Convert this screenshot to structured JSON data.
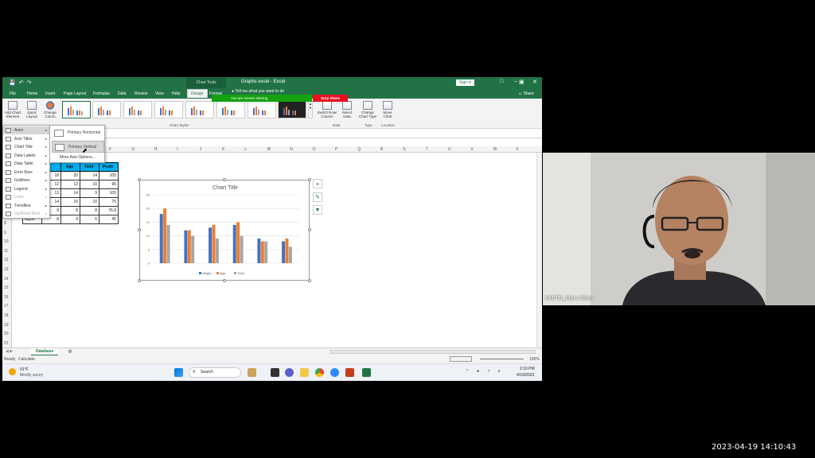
{
  "excel": {
    "title": "Graphs excel  -  Excel",
    "context_tab": "Chart Tools",
    "signin": "Sign in",
    "tabs": [
      "File",
      "Home",
      "Insert",
      "Page Layout",
      "Formulas",
      "Data",
      "Review",
      "View",
      "Help",
      "Design",
      "Format"
    ],
    "tell_me": "Tell me what you want to do",
    "share": "Share",
    "banner": "You are screen sharing",
    "stop_share": "Stop Share",
    "ribbon": {
      "add_chart_element": "Add Chart Element",
      "quick_layout": "Quick Layout",
      "change_colors": "Change Colors",
      "switch_row_col": "Switch Row/ Column",
      "select_data": "Select Data",
      "change_chart_type": "Change Chart Type",
      "move_chart": "Move Chart",
      "group_chart_styles": "Chart Styles",
      "group_data": "Data",
      "group_type": "Type",
      "group_location": "Location"
    },
    "columns": [
      "F",
      "G",
      "H",
      "I",
      "J",
      "K",
      "L",
      "M",
      "N",
      "O",
      "P",
      "Q",
      "R",
      "S",
      "T",
      "U",
      "V",
      "W",
      "X"
    ],
    "rows": [
      "8",
      "9",
      "10",
      "11",
      "12",
      "13",
      "14",
      "15",
      "16",
      "17",
      "18",
      "19",
      "20",
      "21"
    ],
    "menu": {
      "items": [
        "Axes",
        "Axis Titles",
        "Chart Title",
        "Data Labels",
        "Data Table",
        "Error Bars",
        "Gridlines",
        "Legend",
        "Lines",
        "Trendline",
        "Up/Down Bars"
      ],
      "disabled": [
        "Lines",
        "Up/Down Bars"
      ],
      "submenu": [
        "Primary Horizontal",
        "Primary Vertical"
      ],
      "more": "More Axis Options..."
    },
    "table": {
      "headers": [
        "",
        "Age",
        "Yield",
        "Profit"
      ],
      "rows": [
        [
          "18",
          "20",
          "14",
          "105"
        ],
        [
          "12",
          "12",
          "10",
          "96"
        ],
        [
          "13",
          "14",
          "9",
          "105"
        ],
        [
          "14",
          "15",
          "10",
          "75"
        ],
        [
          "9",
          "8",
          "8",
          "76.8"
        ],
        [
          "8",
          "9",
          "6",
          "45"
        ]
      ],
      "last_label": "Apple"
    },
    "sheet_tab": "Database",
    "status": {
      "ready": "Ready",
      "calc": "Calculate",
      "zoom": "100%"
    },
    "taskbar": {
      "weather_temp": "91°F",
      "weather_desc": "Mostly sunny",
      "search": "Search",
      "time": "2:10 PM",
      "date": "4/19/2023"
    }
  },
  "chart_data": {
    "type": "bar",
    "title": "Chart Title",
    "categories": [
      "1",
      "2",
      "3",
      "4",
      "5",
      "6"
    ],
    "series": [
      {
        "name": "Height",
        "values": [
          18,
          12,
          13,
          14,
          9,
          8
        ],
        "color": "#4472c4"
      },
      {
        "name": "Age",
        "values": [
          20,
          12,
          14,
          15,
          8,
          9
        ],
        "color": "#ed7d31"
      },
      {
        "name": "Yield",
        "values": [
          14,
          10,
          9,
          10,
          8,
          6
        ],
        "color": "#a5a5a5"
      }
    ],
    "ylim": [
      0,
      25
    ],
    "yticks": [
      "0",
      "5",
      "10",
      "15",
      "20",
      "25"
    ],
    "legend": "bottom",
    "grid": true
  },
  "webcam": {
    "name": "KMITD_Marc Abiva"
  },
  "clock": "2023-04-19  14:10:43"
}
